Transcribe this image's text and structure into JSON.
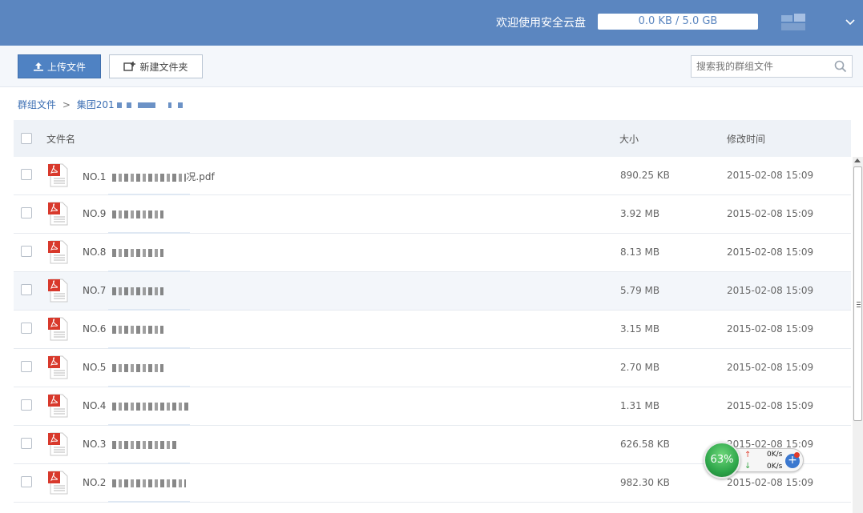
{
  "header": {
    "welcome": "欢迎使用安全云盘",
    "quota": "0.0 KB / 5.0 GB",
    "colors": {
      "bar": "#5b86c0"
    }
  },
  "toolbar": {
    "upload_label": "上传文件",
    "new_folder_label": "新建文件夹",
    "search_placeholder": "搜索我的群组文件"
  },
  "breadcrumb": {
    "root": "群组文件",
    "separator": ">",
    "current": "集团201"
  },
  "table": {
    "columns": {
      "name": "文件名",
      "size": "大小",
      "modified": "修改时间"
    },
    "rows": [
      {
        "prefix": "NO.1",
        "suffix": "况.pdf",
        "size": "890.25 KB",
        "modified": "2015-02-08 15:09"
      },
      {
        "prefix": "NO.9",
        "suffix": "",
        "size": "3.92 MB",
        "modified": "2015-02-08 15:09"
      },
      {
        "prefix": "NO.8",
        "suffix": "",
        "size": "8.13 MB",
        "modified": "2015-02-08 15:09"
      },
      {
        "prefix": "NO.7",
        "suffix": "",
        "size": "5.79 MB",
        "modified": "2015-02-08 15:09"
      },
      {
        "prefix": "NO.6",
        "suffix": "",
        "size": "3.15 MB",
        "modified": "2015-02-08 15:09"
      },
      {
        "prefix": "NO.5",
        "suffix": "",
        "size": "2.70 MB",
        "modified": "2015-02-08 15:09"
      },
      {
        "prefix": "NO.4",
        "suffix": "",
        "size": "1.31 MB",
        "modified": "2015-02-08 15:09"
      },
      {
        "prefix": "NO.3",
        "suffix": "",
        "size": "626.58 KB",
        "modified": "2015-02-08 15:09"
      },
      {
        "prefix": "NO.2",
        "suffix": "",
        "size": "982.30 KB",
        "modified": "2015-02-08 15:09"
      }
    ]
  },
  "speed_widget": {
    "percent": "63%",
    "upload": "0K/s",
    "download": "0K/s"
  }
}
